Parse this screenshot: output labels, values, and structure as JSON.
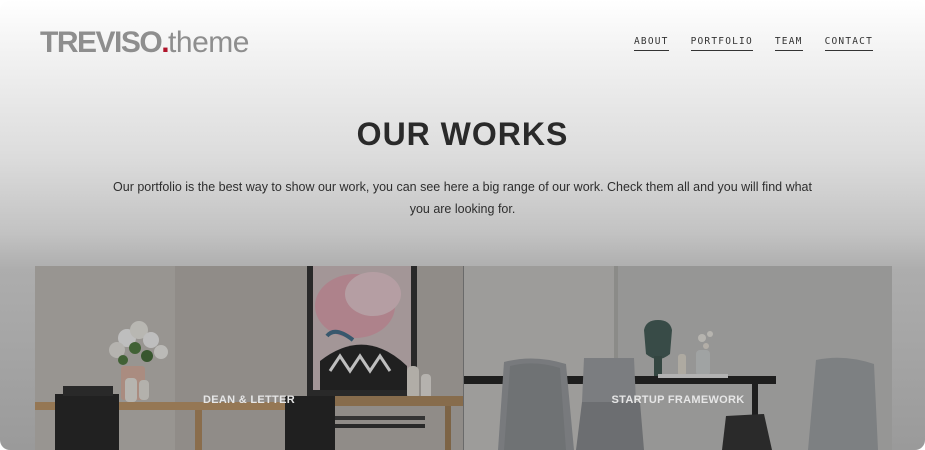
{
  "header": {
    "logo": {
      "brand": "TREVISO",
      "dot": ".",
      "suffix": "theme"
    },
    "nav": [
      {
        "label": "ABOUT"
      },
      {
        "label": "PORTFOLIO"
      },
      {
        "label": "TEAM"
      },
      {
        "label": "CONTACT"
      }
    ]
  },
  "hero": {
    "title": "OUR WORKS",
    "description": "Our portfolio is the best way to show our work, you can see here a big range of our work. Check them all and you will find what you are looking for."
  },
  "portfolio": [
    {
      "title": "DEAN & LETTER"
    },
    {
      "title": "STARTUP FRAMEWORK"
    }
  ],
  "colors": {
    "accent": "#b0152b",
    "text": "#2a2a2a",
    "logo": "#8e8e8e"
  }
}
